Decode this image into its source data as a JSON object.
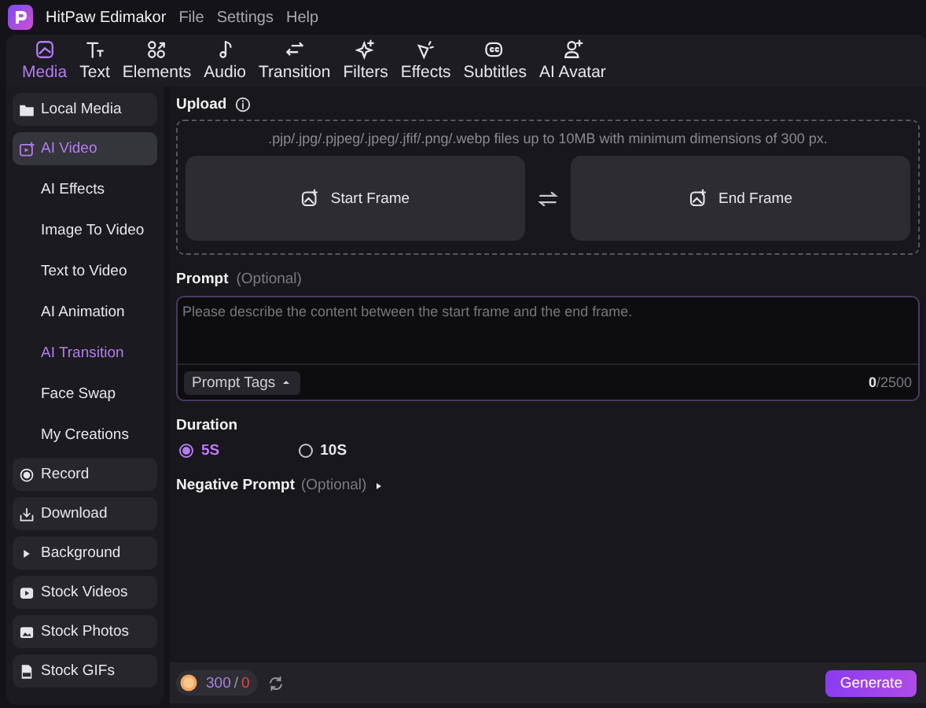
{
  "app": {
    "title": "HitPaw Edimakor",
    "menu": [
      "File",
      "Settings",
      "Help"
    ]
  },
  "toolbar": [
    {
      "label": "Media",
      "selected": true
    },
    {
      "label": "Text",
      "selected": false
    },
    {
      "label": "Elements",
      "selected": false
    },
    {
      "label": "Audio",
      "selected": false
    },
    {
      "label": "Transition",
      "selected": false
    },
    {
      "label": "Filters",
      "selected": false
    },
    {
      "label": "Effects",
      "selected": false
    },
    {
      "label": "Subtitles",
      "selected": false
    },
    {
      "label": "AI Avatar",
      "selected": false
    }
  ],
  "sidebar": [
    {
      "kind": "group",
      "label": "Local Media",
      "selected": false
    },
    {
      "kind": "group",
      "label": "AI Video",
      "selected": true
    },
    {
      "kind": "sub",
      "label": "AI Effects",
      "selected": false
    },
    {
      "kind": "sub",
      "label": "Image To Video",
      "selected": false
    },
    {
      "kind": "sub",
      "label": "Text to Video",
      "selected": false
    },
    {
      "kind": "sub",
      "label": "AI Animation",
      "selected": false
    },
    {
      "kind": "sub",
      "label": "AI Transition",
      "selected": true
    },
    {
      "kind": "sub",
      "label": "Face Swap",
      "selected": false
    },
    {
      "kind": "sub",
      "label": "My Creations",
      "selected": false
    },
    {
      "kind": "group",
      "label": "Record",
      "selected": false
    },
    {
      "kind": "group",
      "label": "Download",
      "selected": false
    },
    {
      "kind": "group",
      "label": "Background",
      "selected": false
    },
    {
      "kind": "group",
      "label": "Stock Videos",
      "selected": false
    },
    {
      "kind": "group",
      "label": "Stock Photos",
      "selected": false
    },
    {
      "kind": "group",
      "label": "Stock GIFs",
      "selected": false
    }
  ],
  "upload": {
    "heading": "Upload",
    "hint": ".pjp/.jpg/.pjpeg/.jpeg/.jfif/.png/.webp files up to 10MB with minimum dimensions of 300 px.",
    "frames": [
      "Start Frame",
      "End Frame"
    ]
  },
  "prompt": {
    "heading": "Prompt",
    "optional": "(Optional)",
    "placeholder": "Please describe the content between the start frame and the end frame.",
    "tags_button": "Prompt Tags",
    "counter": "**0**/2500"
  },
  "duration": {
    "heading": "Duration",
    "options": [
      {
        "label": "5S",
        "selected": true
      },
      {
        "label": "10S",
        "selected": false
      }
    ]
  },
  "negative_prompt": {
    "heading": "Negative Prompt",
    "optional": "(Optional)",
    "expanded": false
  },
  "footer": {
    "credits": "300",
    "separator": "/",
    "credits_extra": "0",
    "button": "Generate"
  }
}
